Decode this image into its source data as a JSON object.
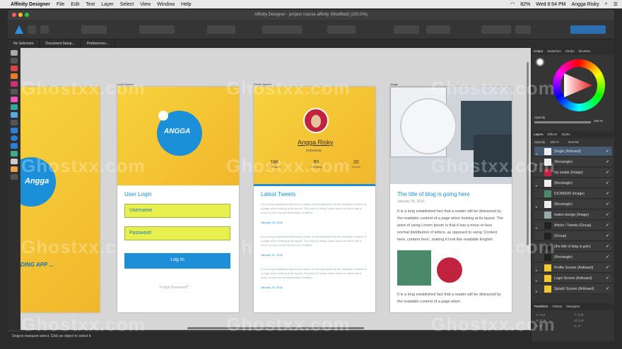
{
  "menubar": {
    "apple": "",
    "app": "Affinity Designer",
    "items": [
      "File",
      "Edit",
      "Text",
      "Layer",
      "Select",
      "View",
      "Window",
      "Help"
    ],
    "battery": "82%",
    "clock": "Wed 8:54 PM",
    "user": "Angga Risky"
  },
  "window": {
    "title": "Affinity Designer - project course affinity (Modified) (100.0%)"
  },
  "context": {
    "items": [
      "No Selection",
      "Document Setup...",
      "Preferences..."
    ]
  },
  "status": {
    "text": "Drag to marquee select. Click an object to select it."
  },
  "artboards": {
    "splash": {
      "brand": "Angga",
      "tagline": "DING APP ..."
    },
    "login": {
      "label": "Login Screen",
      "brand": "ANGGA",
      "heading": "User Login",
      "username": "Username",
      "password": "Password",
      "button": "Log In",
      "forgot": "Forgot Password?"
    },
    "profile": {
      "label": "Profile Screen",
      "name": "Angga Risky",
      "country": "Indonesia",
      "stats": [
        {
          "n": "18K",
          "l": "Followers"
        },
        {
          "n": "80",
          "l": "Following"
        },
        {
          "n": "20",
          "l": "Tweets"
        }
      ],
      "heading": "Latest Tweets",
      "tweet": "It is a long established fact that a reader will be distracted by the readable content of a page when looking at its layout. The point of using Lorem Ipsum is that it has a more-or-less normal distribution of letters.",
      "date": "January 30, 2016"
    },
    "single": {
      "label": "Single",
      "title": "The title of blog is going here",
      "date": "January 30, 2016",
      "body": "It is a long established fact that a reader will be distracted by the readable content of a page when looking at its layout. The point of using Lorem Ipsum is that it has a more-or-less normal distribution of letters, as opposed to using 'Content here, content here', making it look like readable English.",
      "body2": "It is a long established fact that a reader will be distracted by the readable content of a page when"
    }
  },
  "panel": {
    "tabs": [
      "Colour",
      "Swatches",
      "Stroke",
      "Brushes"
    ],
    "opacity_label": "Opacity",
    "opacity": "100 %",
    "layer_tabs": [
      "Layers",
      "Effects",
      "Styles"
    ],
    "layer_opacity": "Opacity",
    "layer_opacity_val": "100 %",
    "blend": "Normal",
    "layers": [
      "Single (Artboard)",
      "(Rectangle)",
      "my avatar (Image)",
      "(Rectangle)",
      "5JCM0026 (Image)",
      "(Rectangle)",
      "materi-design (Image)",
      "Article / Tweets (Group)",
      "(Group)",
      "(the title of blog is goin)",
      "(Rectangle)",
      "Profile Screen (Artboard)",
      "Login Screen (Artboard)",
      "Splash Screen (Artboard)"
    ],
    "transform_tabs": [
      "Transform",
      "History",
      "Navigator"
    ],
    "tf": [
      "X: 0 pt",
      "Y: 0 pt",
      "W: 0 pt",
      "H: 0 pt",
      "R: 0°",
      "S: 0°"
    ]
  },
  "watermark": "Ghostxx.com"
}
